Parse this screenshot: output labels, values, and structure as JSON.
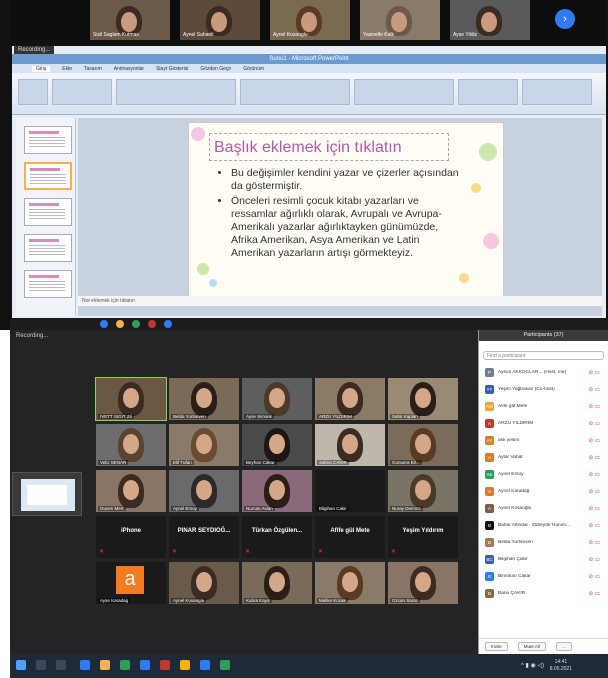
{
  "top": {
    "gallery_strip": [
      {
        "name": "Sizil Saglam Kutmas"
      },
      {
        "name": "Aynel Sahanli"
      },
      {
        "name": "Aynel Kosaoglu"
      },
      {
        "name": "Yasinelle Kalk"
      },
      {
        "name": "Ayse Yildiz"
      }
    ],
    "recording_label": "Recording...",
    "ppt": {
      "window_title": "Sunu1 - Microsoft PowerPoint",
      "tabs": [
        "Giriş",
        "Ekle",
        "Tasarım",
        "Animasyonlar",
        "Slayt Gösterisi",
        "Gözden Geçir",
        "Görünüm"
      ],
      "slide_title": "Başlık eklemek için tıklatın",
      "slide_bullets": [
        "Bu değişimler kendini yazar ve çizerler açısından da göstermiştir.",
        "Önceleri resimli çocuk kitabı yazarları ve ressamlar ağırlıklı olarak, Avrupalı ve Avrupa-Amerikalı yazarlar ağırlıktayken günümüzde, Afrika Amerikan, Asya Amerikan ve Latin Amerikan yazarların artışı görmekteyiz."
      ],
      "notes_placeholder": "Not eklemek için tıklatın"
    }
  },
  "meeting": {
    "recording_label": "Recording...",
    "tiles": [
      {
        "name": "IVETT SIGIT Zil"
      },
      {
        "name": "Belda Yurtseven"
      },
      {
        "name": "Ayse Simsek"
      },
      {
        "name": "ARZU YILDIRIM"
      },
      {
        "name": "Sahir Kaplan"
      },
      {
        "name": "Veliz SENAR"
      },
      {
        "name": "Elif Tufan"
      },
      {
        "name": "Beyhan Cakar"
      },
      {
        "name": "Salma CAKIR"
      },
      {
        "name": "Gonuera Bil..."
      },
      {
        "name": "Guven Mert"
      },
      {
        "name": "Aynel Ersoy"
      },
      {
        "name": "Nurcan Aslan"
      },
      {
        "name": "Bilgihan Cakir"
      },
      {
        "name": "Nuray Demirci"
      }
    ],
    "name_only_tiles": [
      "iPhone",
      "PINAR SEYDIOĞ...",
      "Türkan Özgülen...",
      "Afife gül Mete",
      "Yeşim Yıldırım"
    ],
    "bottom_tiles": [
      {
        "name": "Ayse Karadag"
      },
      {
        "name": "Aynel Kosaoglu"
      },
      {
        "name": "Kubra Kaya"
      },
      {
        "name": "Melike Kocak"
      },
      {
        "name": "Ozcan Sarac"
      }
    ],
    "bottom_initial": "a",
    "participants_panel": {
      "title": "Participants (37)",
      "search_placeholder": "Find a participant",
      "participants": [
        {
          "initials": "P",
          "name": "Aysun AKKOCLAR... (Host, me)",
          "color": "#6d7e92"
        },
        {
          "initials": "YY",
          "name": "Yeşim Yağbasan (Co-host)",
          "color": "#3a5db0"
        },
        {
          "initials": "AM",
          "name": "Afife gül Mete",
          "color": "#f0a43a"
        },
        {
          "initials": "A",
          "name": "ARZU YILDIRIM",
          "color": "#c0392b"
        },
        {
          "initials": "AY",
          "name": "ask yesim",
          "color": "#e07a2c"
        },
        {
          "initials": "A",
          "name": "Aytar Vahat",
          "color": "#e07a2c"
        },
        {
          "initials": "AE",
          "name": "Aynel Ersoy",
          "color": "#2f9e5c"
        },
        {
          "initials": "A",
          "name": "Aynel Karadağ",
          "color": "#e07a2c"
        },
        {
          "initials": "A",
          "name": "Aynel Kosaoğlu",
          "color": "#7a5c4a"
        },
        {
          "initials": "B",
          "name": "Bahar Altindal - Zübeyde Hanım...",
          "color": "#111111"
        },
        {
          "initials": "B",
          "name": "Belda Yurtseven",
          "color": "#a07a5a"
        },
        {
          "initials": "BC",
          "name": "Bilgihan Çakır",
          "color": "#3a5db0"
        },
        {
          "initials": "B",
          "name": "Binnihan Cakar",
          "color": "#2d7cf6"
        },
        {
          "initials": "B",
          "name": "Banu ÇAKIR",
          "color": "#8a6a4a"
        }
      ],
      "invite_label": "Invite",
      "mute_all_label": "Mute All",
      "more_label": "..."
    }
  },
  "taskbar": {
    "time": "14:41",
    "date": "8.05.2021"
  }
}
